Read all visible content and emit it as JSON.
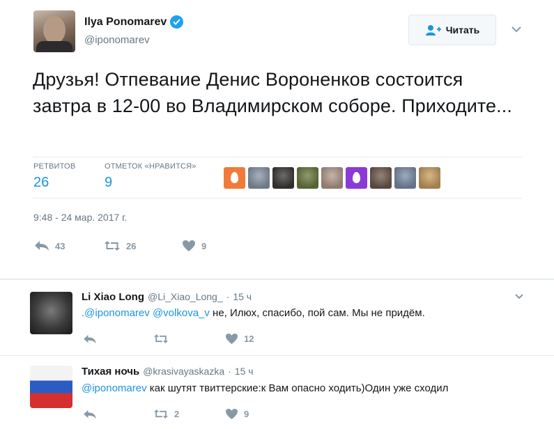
{
  "tweet": {
    "author_name": "Ilya Ponomarev",
    "author_handle": "@iponomarev",
    "follow_label": "Читать",
    "text": "Друзья! Отпевание Денис Вороненков состоится завтра в 12-00 во Владимирском соборе. Приходите...",
    "retweets_label": "РЕТВИТОВ",
    "retweets_count": "26",
    "likes_label": "ОТМЕТОК «НРАВИТСЯ»",
    "likes_count": "9",
    "timestamp": "9:48 - 24 мар. 2017 г.",
    "actions": {
      "reply_count": "43",
      "retweet_count": "26",
      "like_count": "9"
    },
    "likers": [
      {
        "kind": "egg",
        "color": "#f07b39"
      },
      {
        "kind": "photo",
        "color": "#8a97a8"
      },
      {
        "kind": "photo",
        "color": "#3d3a38"
      },
      {
        "kind": "photo",
        "color": "#6b7a3e"
      },
      {
        "kind": "photo",
        "color": "#b49a8c"
      },
      {
        "kind": "egg",
        "color": "#8a3bd6"
      },
      {
        "kind": "photo",
        "color": "#6f5a4d"
      },
      {
        "kind": "photo",
        "color": "#7d8fa8"
      },
      {
        "kind": "photo",
        "color": "#c8a060"
      }
    ]
  },
  "replies": [
    {
      "name": "Li Xiao Long",
      "handle": "@Li_Xiao_Long_",
      "dot": "·",
      "time": "15 ч",
      "mention1": ".@iponomarev",
      "mention2": "@volkova_v",
      "text": " не, Илюх, спасибо, пой сам. Мы не придём.",
      "reply_count": "",
      "retweet_count": "",
      "like_count": "12"
    },
    {
      "name": "Тихая ночь",
      "handle": "@krasivayaskazka",
      "dot": "·",
      "time": "15 ч",
      "mention1": "@iponomarev",
      "text": " как шутят твиттерские:к Вам опасно ходить)Один уже сходил",
      "reply_count": "",
      "retweet_count": "2",
      "like_count": "9"
    }
  ],
  "colors": {
    "accent": "#1b95e0",
    "verified": "#1da1f2",
    "muted": "#657786",
    "icon": "#8899a6"
  }
}
